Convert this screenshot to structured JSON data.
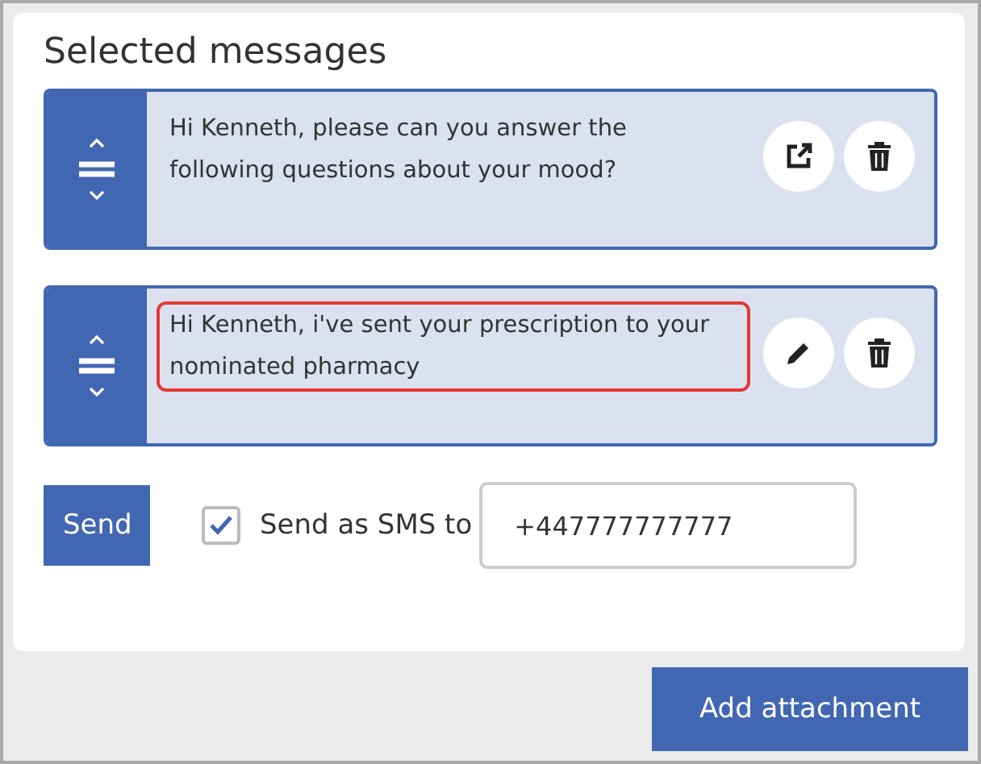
{
  "title": "Selected messages",
  "messages": [
    {
      "text": "Hi Kenneth, please can you answer the following questions about your mood?",
      "kind": "open",
      "highlighted": false
    },
    {
      "text": "Hi Kenneth, i've sent your prescription to your nominated pharmacy",
      "kind": "edit",
      "highlighted": true
    }
  ],
  "send_button": "Send",
  "sms": {
    "checked": true,
    "label": "Send as SMS to",
    "value": "+447777777777"
  },
  "add_attachment_button": "Add attachment"
}
